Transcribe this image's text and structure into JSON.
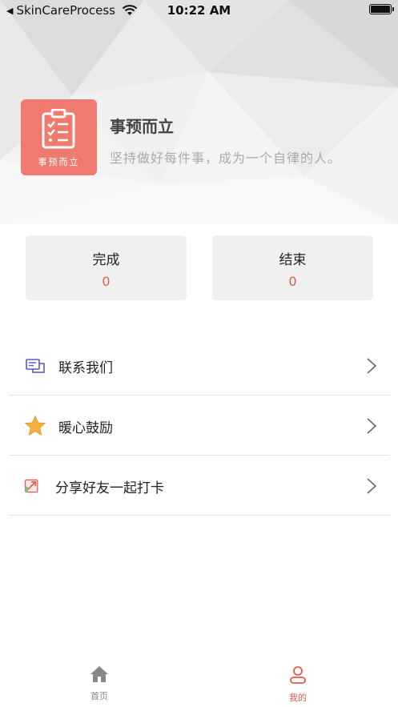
{
  "status_bar": {
    "back_app": "SkinCareProcess",
    "time": "10:22 AM"
  },
  "profile": {
    "logo_text": "事预而立",
    "title": "事预而立",
    "subtitle": "坚持做好每件事，成为一个自律的人。",
    "logo_color": "#f07a6f"
  },
  "stats": [
    {
      "label": "完成",
      "value": "0"
    },
    {
      "label": "结束",
      "value": "0"
    }
  ],
  "menu": [
    {
      "label": "联系我们",
      "icon": "message-icon"
    },
    {
      "label": "暖心鼓励",
      "icon": "star-icon"
    },
    {
      "label": "分享好友一起打卡",
      "icon": "share-icon"
    }
  ],
  "tabs": [
    {
      "label": "首页",
      "icon": "home-icon",
      "active": false
    },
    {
      "label": "我的",
      "icon": "user-icon",
      "active": true
    }
  ],
  "colors": {
    "accent": "#e35a4c",
    "card_bg": "#f0f0f0",
    "inactive_tab": "#888888"
  }
}
